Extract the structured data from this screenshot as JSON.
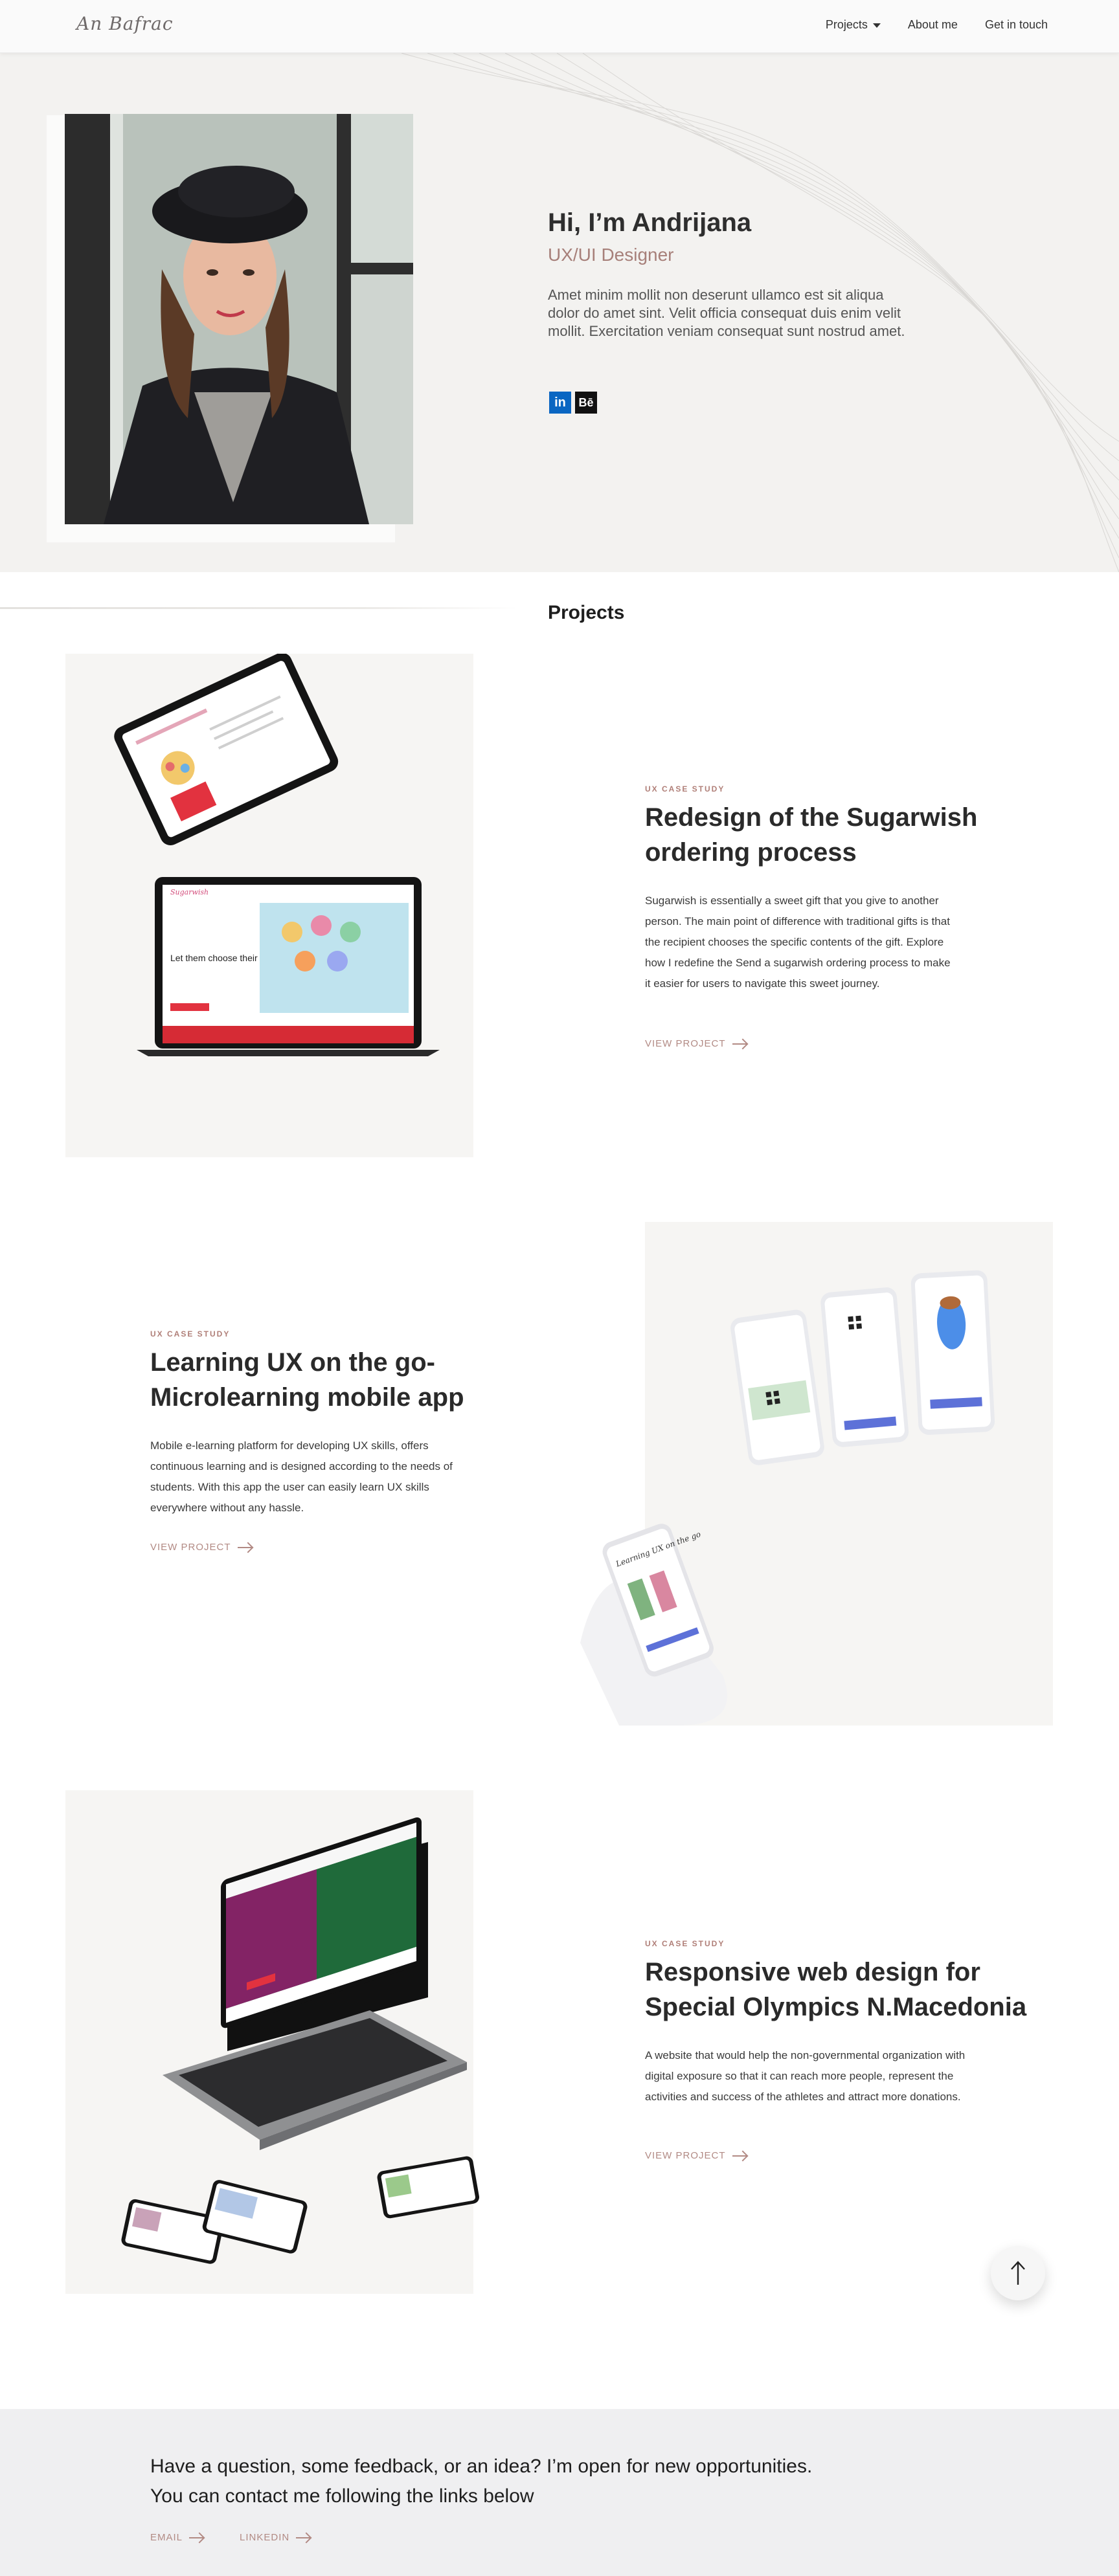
{
  "nav": {
    "logo": "An Bafrac",
    "links": [
      "Projects",
      "About me",
      "Get in touch"
    ]
  },
  "hero": {
    "title": "Hi, I’m Andrijana",
    "role": "UX/UI Designer",
    "text": "Amet minim mollit non deserunt ullamco est sit aliqua dolor do amet sint. Velit officia consequat duis enim velit mollit. Exercitation veniam consequat sunt nostrud amet.",
    "social": [
      "in",
      "Bē"
    ]
  },
  "projects_title": "Projects",
  "projects": [
    {
      "eyebrow": "UX CASE STUDY",
      "title": "Redesign of the Sugarwish ordering process",
      "description": "Sugarwish is essentially a sweet gift that you give to another person. The main point of difference with traditional gifts is that the recipient chooses the specific contents of the gift. Explore how I redefine the Send a sugarwish ordering process to make it easier for users to navigate this sweet journey.",
      "link": "VIEW PROJECT",
      "mock_heading": "Let them choose their favorites",
      "mock_brand": "Sugarwish"
    },
    {
      "eyebrow": "UX CASE STUDY",
      "title": "Learning UX on the go- Microlearning mobile app",
      "description": "Mobile e-learning platform for developing UX skills, offers continuous learning and is designed according to the needs of students. With this app the user can easily learn UX skills everywhere without any hassle.",
      "link": "VIEW PROJECT",
      "mock_heading": "Learning UX on the go"
    },
    {
      "eyebrow": "UX CASE STUDY",
      "title": "Responsive web design for Special Olympics N.Macedonia",
      "description": "A website that would help the non-governmental organization with digital exposure so that it can reach more people, represent the activities and success of the athletes and attract more donations.",
      "link": "VIEW PROJECT"
    }
  ],
  "footer": {
    "line1": "Have a question, some feedback, or an idea? I’m open for new opportunities.",
    "line2": "You can contact me following the links below",
    "links": [
      "EMAIL",
      "LINKEDIN"
    ]
  },
  "colors": {
    "accent": "#b07f78",
    "hero_bg": "#f3f2f0",
    "footer_bg": "#efeff1",
    "linkedin": "#0a66c2"
  }
}
